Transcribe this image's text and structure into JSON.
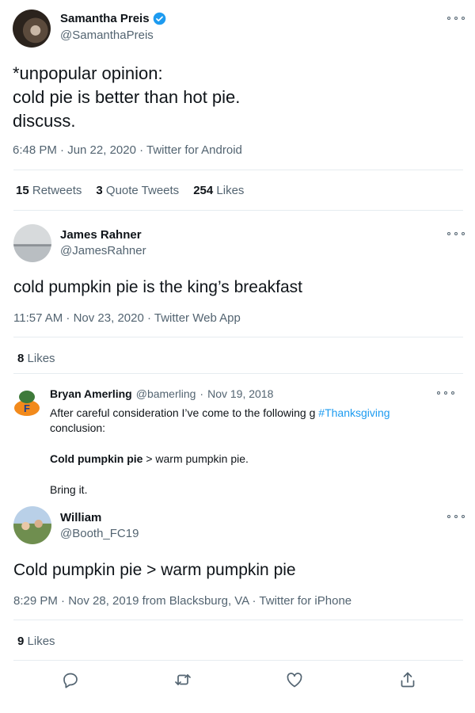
{
  "tweet_main": {
    "name": "Samantha Preis",
    "handle": "@SamanthaPreis",
    "lines": [
      "*unpopular opinion:",
      "cold pie is better than hot pie.",
      "discuss."
    ],
    "meta": "6:48 PM · Jun 22, 2020 · Twitter for Android",
    "stats": [
      {
        "num": "15",
        "label": "Retweets"
      },
      {
        "num": "3",
        "label": "Quote Tweets"
      },
      {
        "num": "254",
        "label": "Likes"
      }
    ]
  },
  "reply_james": {
    "name": "James Rahner",
    "handle": "@JamesRahner",
    "text": "cold pumpkin pie is the king’s breakfast",
    "meta": "11:57 AM · Nov 23, 2020 · Twitter Web App",
    "likes_num": "8",
    "likes_label": "Likes"
  },
  "quoted_bryan": {
    "name": "Bryan Amerling",
    "handle": "@bamerling",
    "date": "Nov 19, 2018",
    "line1": "After careful consideration I’ve come to the following g",
    "hashtag": "#Thanksgiving",
    "line2": "conclusion:",
    "line3_bold": "Cold pumpkin pie",
    "line3_rest": " > warm pumpkin pie.",
    "line4": "Bring it."
  },
  "reply_william": {
    "name": "William",
    "handle": "@Booth_FC19",
    "text": "Cold pumpkin pie > warm pumpkin pie",
    "meta": "8:29 PM · Nov 28, 2019 from Blacksburg, VA · Twitter for iPhone",
    "likes_num": "9",
    "likes_label": "Likes"
  },
  "icons": {
    "verified": "verified-badge-icon",
    "more": "more-options-icon",
    "reply": "reply-icon",
    "retweet": "retweet-icon",
    "like": "like-icon",
    "share": "share-icon"
  },
  "colors": {
    "accent": "#1d9bf0",
    "text": "#0f1419",
    "secondary": "#536471",
    "divider": "#e6ecf0"
  }
}
